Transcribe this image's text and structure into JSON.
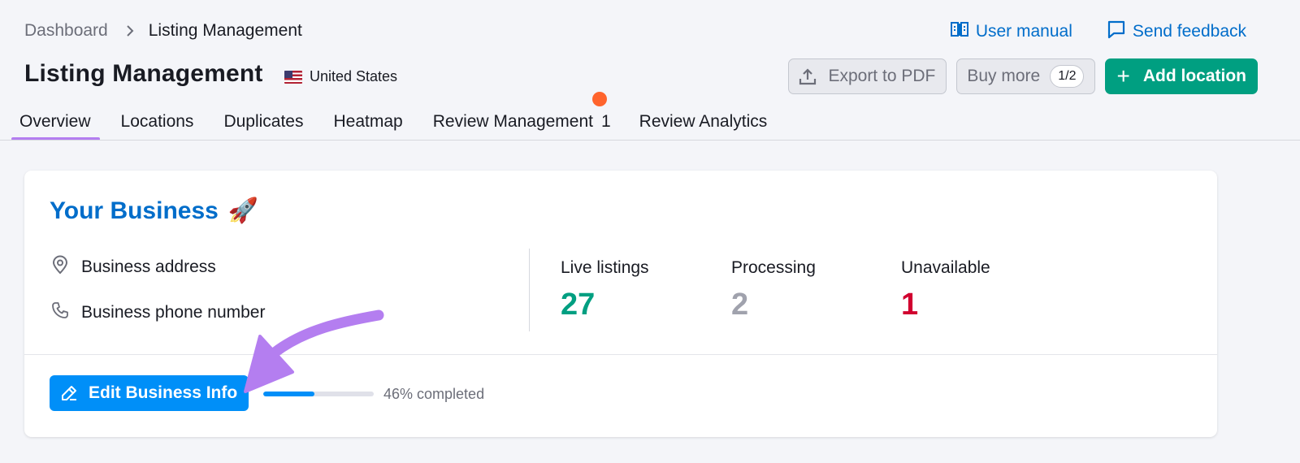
{
  "breadcrumb": {
    "root": "Dashboard",
    "current": "Listing Management"
  },
  "top_links": {
    "manual": "User manual",
    "feedback": "Send feedback"
  },
  "header": {
    "title": "Listing Management",
    "country": "United States"
  },
  "actions": {
    "export": "Export to PDF",
    "buy_more": "Buy more",
    "buy_count": "1/2",
    "add_location": "Add location"
  },
  "tabs": [
    {
      "label": "Overview"
    },
    {
      "label": "Locations"
    },
    {
      "label": "Duplicates"
    },
    {
      "label": "Heatmap"
    },
    {
      "label": "Review Management",
      "count": "1"
    },
    {
      "label": "Review Analytics"
    }
  ],
  "card": {
    "title": "Your Business",
    "title_emoji": "🚀",
    "address_label": "Business address",
    "phone_label": "Business phone number",
    "stats": [
      {
        "label": "Live listings",
        "value": "27",
        "color": "#009f81"
      },
      {
        "label": "Processing",
        "value": "2",
        "color": "#a0a2ad"
      },
      {
        "label": "Unavailable",
        "value": "1",
        "color": "#d1002f"
      }
    ],
    "edit_button": "Edit Business Info",
    "progress_percent": 46,
    "progress_text": "46% completed"
  },
  "colors": {
    "accent": "#006dca",
    "green": "#009f81",
    "blue_button": "#008ff8",
    "tab_underline": "#b47ef0",
    "notification": "#ff642d",
    "annotation_arrow": "#b47ef0"
  },
  "icons": [
    "chevron-right-icon",
    "book-icon",
    "feedback-icon",
    "us-flag-icon",
    "upload-icon",
    "plus-icon",
    "location-pin-icon",
    "phone-icon",
    "pencil-icon"
  ]
}
